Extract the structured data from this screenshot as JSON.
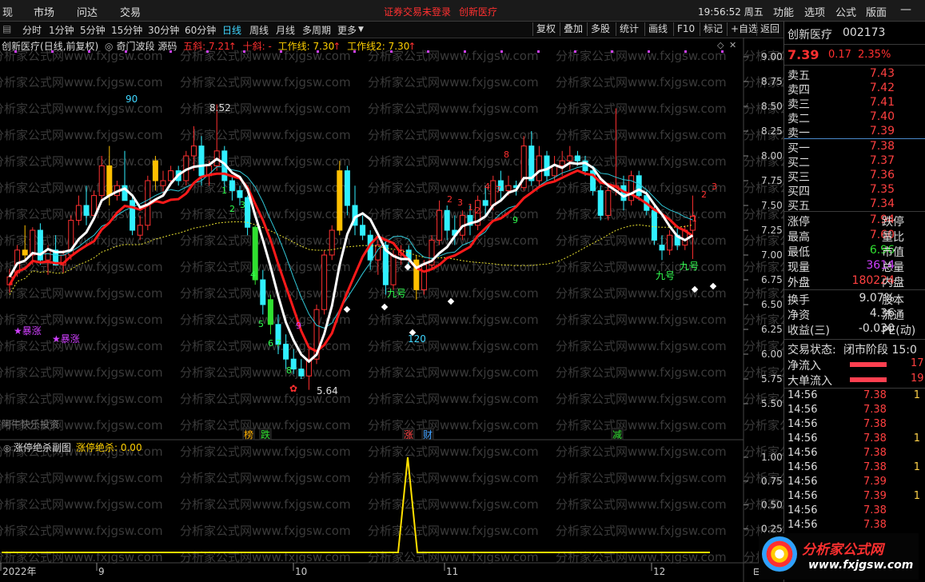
{
  "topmenu": {
    "items": [
      "现",
      "市场",
      "问达",
      "交易"
    ],
    "notice": "证券交易未登录",
    "stock_link": "创新医疗",
    "clock": "19:56:52 周五",
    "right_items": [
      "功能",
      "选项",
      "公式",
      "版面"
    ]
  },
  "periods": [
    "分时",
    "1分钟",
    "5分钟",
    "15分钟",
    "30分钟",
    "60分钟",
    "日线",
    "周线",
    "月线",
    "多周期",
    "更多"
  ],
  "active_period": "日线",
  "toolbar": [
    "复权",
    "叠加",
    "多股",
    "统计",
    "画线",
    "F10",
    "标记",
    "+自选",
    "返回"
  ],
  "chart_info": {
    "stock": "创新医疗",
    "mode": "(日线,前复权)",
    "indicator": "奇门波段 源码",
    "wuxie_label": "五斜: 7.21",
    "shixie_label": "十斜: -",
    "workline1": "工作线: 7.30",
    "workline2": "工作线2: 7.30"
  },
  "price_axis": [
    "9.00",
    "8.75",
    "8.50",
    "8.25",
    "8.00",
    "7.75",
    "7.50",
    "7.25",
    "7.00",
    "6.75",
    "6.50",
    "6.25",
    "6.00",
    "5.75",
    "5.50"
  ],
  "annotations": {
    "high_label": "8.52",
    "low_label": "5.64",
    "count_90": "90",
    "count_120": "120",
    "baozhang_1": "★暴涨",
    "baozhang_2": "★暴涨",
    "jiuhao_1": "九号",
    "jiuhao_2": "九号",
    "jiuhao_3": "九号",
    "watermark_text": "分析家公式网www.fxjgsw.com",
    "author": "阿牛快乐投资"
  },
  "event_markers": [
    {
      "text": "榜",
      "color": "#ffb000"
    },
    {
      "text": "跌",
      "color": "#30e030"
    },
    {
      "text": "涨",
      "color": "#ff4040"
    },
    {
      "text": "财",
      "color": "#40a0ff"
    },
    {
      "text": "减",
      "color": "#30e030"
    }
  ],
  "sub_chart": {
    "title": "涨停绝杀副图",
    "value_label": "涨停绝杀: 0.00",
    "axis": [
      "1.00",
      "0.75",
      "0.50",
      "0.25"
    ]
  },
  "date_axis": [
    "2022年",
    "9",
    "10",
    "11",
    "12"
  ],
  "quote": {
    "name": "创新医疗",
    "code": "002173",
    "price": "7.39",
    "change": "0.17",
    "pct": "2.35%",
    "sell": [
      {
        "label": "卖五",
        "price": "7.43"
      },
      {
        "label": "卖四",
        "price": "7.42"
      },
      {
        "label": "卖三",
        "price": "7.41"
      },
      {
        "label": "卖二",
        "price": "7.40"
      },
      {
        "label": "卖一",
        "price": "7.39"
      }
    ],
    "buy": [
      {
        "label": "买一",
        "price": "7.38"
      },
      {
        "label": "买二",
        "price": "7.37"
      },
      {
        "label": "买三",
        "price": "7.36"
      },
      {
        "label": "买四",
        "price": "7.35"
      },
      {
        "label": "买五",
        "price": "7.34"
      }
    ],
    "stats": [
      {
        "l": "涨停",
        "v": "7.94",
        "l2": "跌停",
        "c": "#ff4040"
      },
      {
        "l": "最高",
        "v": "7.60",
        "l2": "量比",
        "c": "#ff4040"
      },
      {
        "l": "最低",
        "v": "6.96",
        "l2": "市值",
        "c": "#30e030"
      },
      {
        "l": "现量",
        "v": "3614",
        "l2": "总量",
        "c": "#d040ff"
      },
      {
        "l": "外盘",
        "v": "180224",
        "l2": "内盘",
        "c": "#ff4040"
      }
    ],
    "stats2": [
      {
        "l": "换手",
        "v": "9.07%",
        "l2": "股本"
      },
      {
        "l": "净资",
        "v": "4.36",
        "l2": "流通"
      },
      {
        "l": "收益(三)",
        "v": "-0.030",
        "l2": "PE(动)"
      }
    ],
    "trade_status_label": "交易状态:",
    "trade_status": "闭市阶段 15:0",
    "net_inflow_label": "净流入",
    "net_inflow_value": "17",
    "big_inflow_label": "大单流入",
    "big_inflow_value": "19",
    "ticks": [
      {
        "t": "14:56",
        "p": "7.38",
        "n": "1"
      },
      {
        "t": "14:56",
        "p": "7.38",
        "n": ""
      },
      {
        "t": "14:56",
        "p": "7.38",
        "n": ""
      },
      {
        "t": "14:56",
        "p": "7.38",
        "n": "1"
      },
      {
        "t": "14:56",
        "p": "7.38",
        "n": ""
      },
      {
        "t": "14:56",
        "p": "7.38",
        "n": "1"
      },
      {
        "t": "14:56",
        "p": "7.39",
        "n": ""
      },
      {
        "t": "14:56",
        "p": "7.39",
        "n": "1"
      },
      {
        "t": "14:56",
        "p": "7.38",
        "n": ""
      },
      {
        "t": "14:56",
        "p": "7.38",
        "n": ""
      }
    ]
  },
  "logo": {
    "text": "分析家公式网",
    "url": "www.fxjgsw.com"
  },
  "colors": {
    "up": "#ff3030",
    "down": "#30f0ff",
    "gold": "#ffc000",
    "ma_white": "#ffffff",
    "ma_red": "#ff1a1a",
    "ma_yellow": "#e8e030",
    "ma_cyan": "#30c8d8"
  }
}
